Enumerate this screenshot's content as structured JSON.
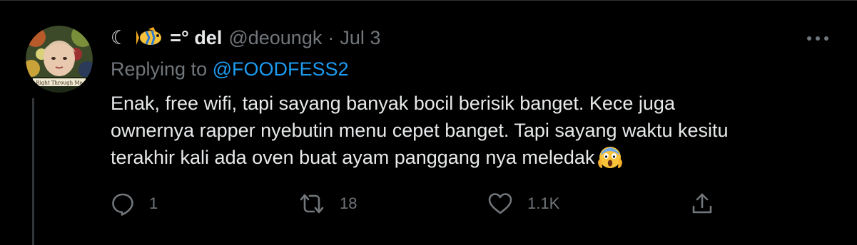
{
  "tweet": {
    "display_name_prefix": "☾",
    "display_name_suffix": "=° del",
    "handle": "@deoungk",
    "separator": "·",
    "date": "Jul 3",
    "replying_label": "Replying to ",
    "replying_to": "@FOODFESS2",
    "body_lines": [
      "Enak, free wifi, tapi sayang banyak bocil berisik banget. Kece juga",
      "ownernya rapper nyebutin menu cepet banget. Tapi sayang waktu kesitu",
      "terakhir kali ada oven buat ayam panggang nya meledak"
    ],
    "avatar_caption": "Right Through Me",
    "emojis": [
      "tropical-fish",
      "face-screaming-in-fear"
    ]
  },
  "actions": {
    "reply_icon": "reply-icon",
    "reply_count": "1",
    "retweet_icon": "retweet-icon",
    "retweet_count": "18",
    "like_icon": "heart-icon",
    "like_count": "1.1K",
    "share_icon": "share-icon"
  },
  "colors": {
    "background": "#000000",
    "text": "#e7e9ea",
    "secondary": "#71767b",
    "link": "#1d9bf0",
    "divider": "#2f3336"
  }
}
